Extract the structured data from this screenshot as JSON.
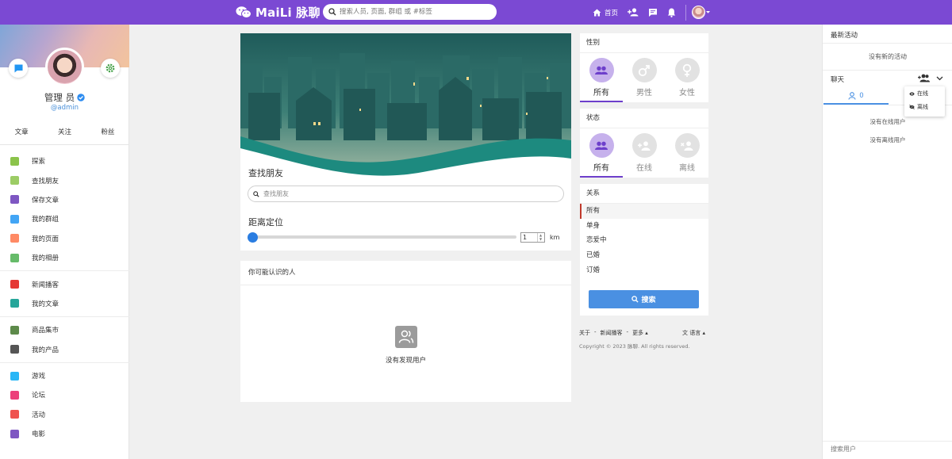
{
  "topbar": {
    "brand": "MaiLi 脉聊",
    "search_placeholder": "搜索人员, 页面, 群组 或 #标签",
    "home_label": "首页"
  },
  "profile": {
    "name": "管理 员",
    "handle": "@admin",
    "stats": [
      "文章",
      "关注",
      "粉丝"
    ]
  },
  "sidebar": {
    "groups": [
      [
        {
          "label": "探索",
          "icon": "explore-icon",
          "color": "#8bc34a"
        },
        {
          "label": "查找朋友",
          "icon": "map-pin-icon",
          "color": "#9ccc65"
        },
        {
          "label": "保存文章",
          "icon": "bookmark-icon",
          "color": "#7e57c2"
        },
        {
          "label": "我的群组",
          "icon": "groups-icon",
          "color": "#42a5f5"
        },
        {
          "label": "我的页面",
          "icon": "flag-icon",
          "color": "#ff8a65"
        },
        {
          "label": "我的相册",
          "icon": "photo-album-icon",
          "color": "#66bb6a"
        }
      ],
      [
        {
          "label": "新闻播客",
          "icon": "newspaper-icon",
          "color": "#e53935"
        },
        {
          "label": "我的文章",
          "icon": "book-icon",
          "color": "#26a69a"
        }
      ],
      [
        {
          "label": "商品集市",
          "icon": "store-icon",
          "color": "#5d8a4a"
        },
        {
          "label": "我的产品",
          "icon": "cart-icon",
          "color": "#555555"
        }
      ],
      [
        {
          "label": "游戏",
          "icon": "gamepad-icon",
          "color": "#29b6f6"
        },
        {
          "label": "论坛",
          "icon": "forum-icon",
          "color": "#ec407a"
        },
        {
          "label": "活动",
          "icon": "calendar-icon",
          "color": "#ef5350"
        },
        {
          "label": "电影",
          "icon": "film-icon",
          "color": "#7e57c2"
        }
      ]
    ]
  },
  "find": {
    "title": "查找朋友",
    "input_placeholder": "查找朋友",
    "distance_title": "距离定位",
    "distance_value": "1",
    "distance_unit": "km",
    "slider_fraction": 0
  },
  "maybe": {
    "title": "你可能认识的人",
    "empty": "没有发现用户"
  },
  "filters": {
    "gender": {
      "title": "性别",
      "options": [
        "所有",
        "男性",
        "女性"
      ],
      "active": 0
    },
    "status": {
      "title": "状态",
      "options": [
        "所有",
        "在线",
        "离线"
      ],
      "active": 0
    },
    "relation": {
      "title": "关系",
      "options": [
        "所有",
        "单身",
        "恋爱中",
        "已婚",
        "订婚"
      ],
      "active": 0
    },
    "search_btn": "搜索"
  },
  "footer": {
    "links": [
      "关于",
      "-",
      "新闻播客",
      "-",
      "更多 ▴",
      "文 语言 ▴"
    ],
    "copyright": "Copyright © 2023 脉聊. All rights reserved."
  },
  "rightbar": {
    "activity_title": "最新活动",
    "no_activity": "没有新的活动",
    "chat_title": "聊天",
    "online_count": "0",
    "no_online": "没有在线用户",
    "no_offline": "没有离线用户",
    "search_placeholder": "搜索用户",
    "dropdown": [
      "在线",
      "离线"
    ]
  },
  "colors": {
    "topbar": "#7b49d3",
    "accent": "#4a90e2",
    "active_filter": "#6d3fcb"
  }
}
